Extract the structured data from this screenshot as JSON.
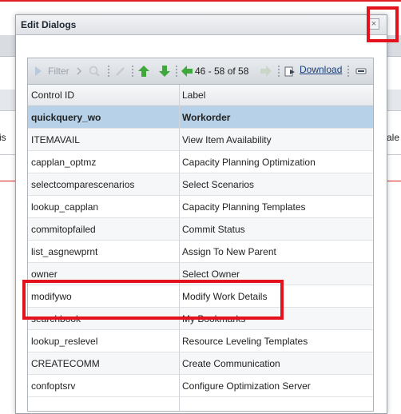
{
  "background": {
    "left_fragment": "is",
    "right_fragment": "ale"
  },
  "dialog": {
    "title": "Edit Dialogs",
    "close_label": "×"
  },
  "toolbar": {
    "filter_label": "Filter",
    "page_info": "46 - 58 of 58",
    "download_label": "Download"
  },
  "table": {
    "columns": [
      "Control ID",
      "Label"
    ],
    "rows": [
      {
        "id": "quickquery_wo",
        "label": "Workorder",
        "selected": true
      },
      {
        "id": "ITEMAVAIL",
        "label": "View Item Availability"
      },
      {
        "id": "capplan_optmz",
        "label": "Capacity Planning Optimization"
      },
      {
        "id": "selectcomparescenarios",
        "label": "Select Scenarios"
      },
      {
        "id": "lookup_capplan",
        "label": "Capacity Planning Templates"
      },
      {
        "id": "commitopfailed",
        "label": "Commit Status"
      },
      {
        "id": "list_asgnewprnt",
        "label": "Assign To New Parent"
      },
      {
        "id": "owner",
        "label": "Select Owner"
      },
      {
        "id": "modifywo",
        "label": "Modify Work Details"
      },
      {
        "id": "searchbook",
        "label": "My Bookmarks"
      },
      {
        "id": "lookup_reslevel",
        "label": "Resource Leveling Templates"
      },
      {
        "id": "CREATECOMM",
        "label": "Create Communication"
      },
      {
        "id": "confoptsrv",
        "label": "Configure Optimization Server"
      }
    ]
  },
  "colors": {
    "highlight": "#e4121d",
    "selected_row": "#b7d2e8"
  }
}
